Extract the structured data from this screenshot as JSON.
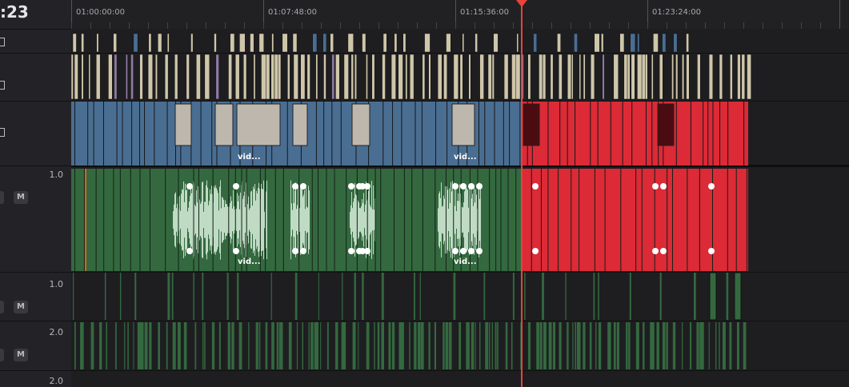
{
  "timeline": {
    "timecode": ":23",
    "ruler_labels": [
      "01:00:00:00",
      "01:07:48:00",
      "01:15:36:00",
      "01:23:24:00"
    ],
    "playhead_position": "01:19:30:00"
  },
  "tracks": {
    "video_1_label": "vid...",
    "video_2_label": "vid...",
    "audio_1": {
      "volume": "1.0",
      "mute_label": "M",
      "clip_label_1": "vid...",
      "clip_label_2": "vid..."
    },
    "audio_2": {
      "volume": "1.0",
      "mute_label": "M"
    },
    "audio_3": {
      "volume": "2.0",
      "mute_label": "M"
    },
    "audio_4": {
      "volume": "2.0"
    }
  },
  "colors": {
    "blue_clip": "#4a6e92",
    "red_clip": "#dc2a36",
    "green_clip": "#34693f",
    "beige_clip": "#cfc6aa",
    "playhead": "#e8433c"
  }
}
